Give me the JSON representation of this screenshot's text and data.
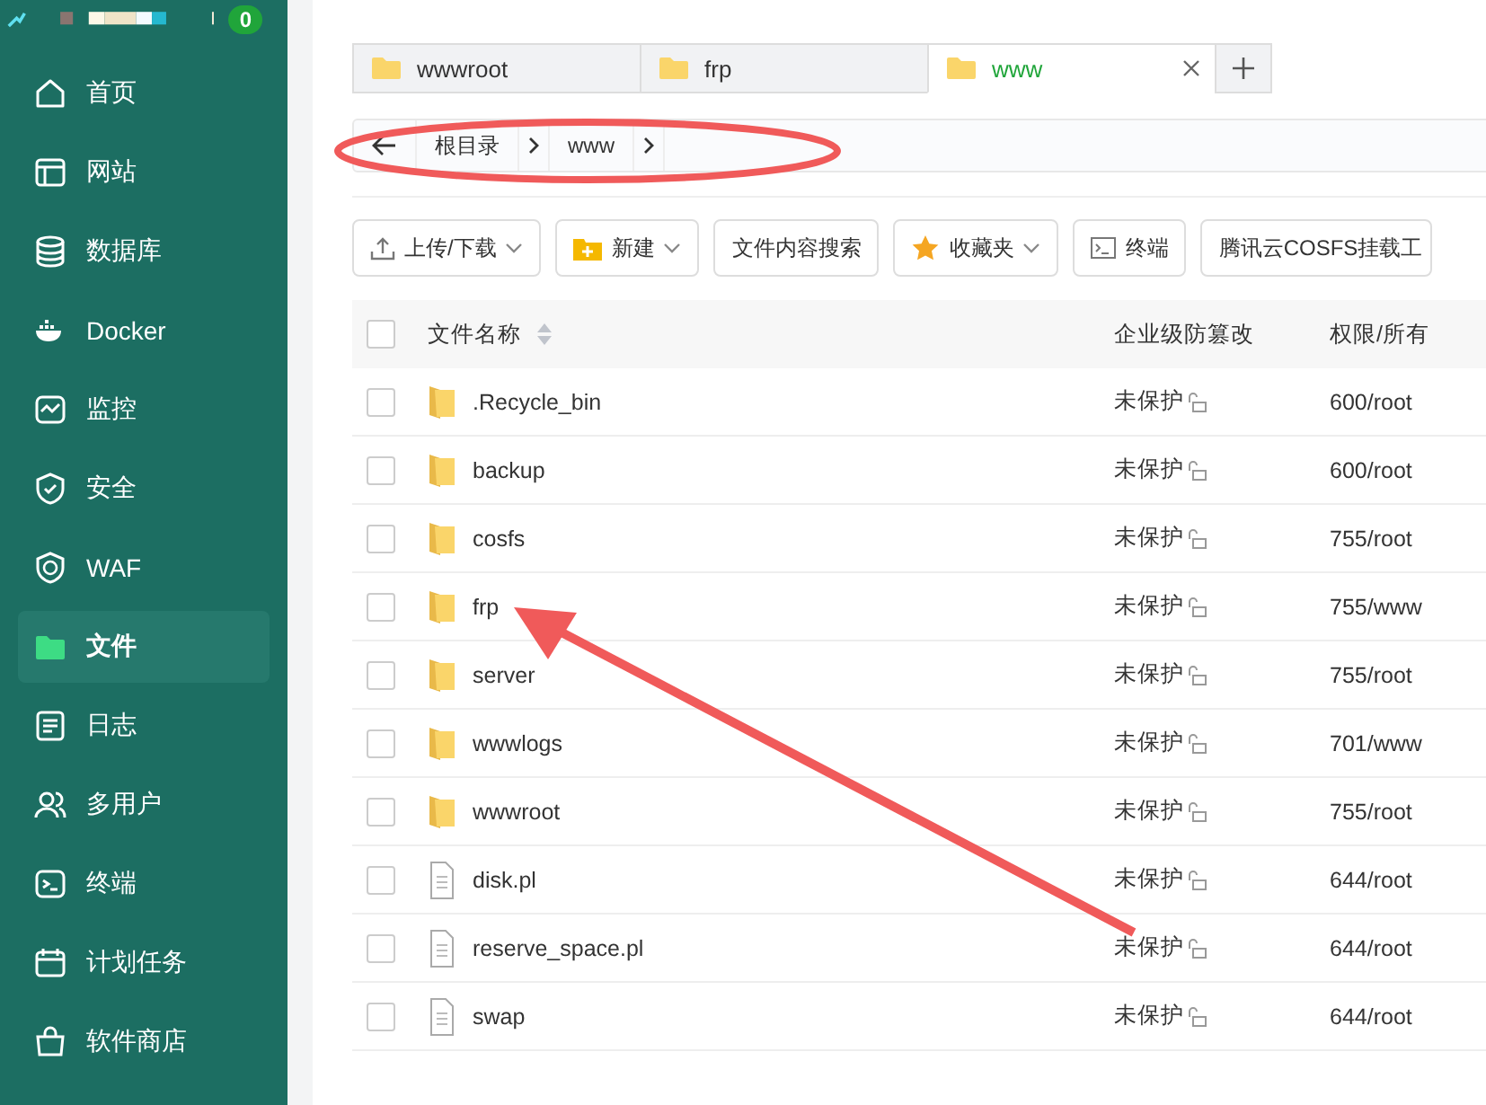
{
  "sidebar": {
    "badge": "0",
    "items": [
      {
        "label": "首页",
        "selected": false
      },
      {
        "label": "网站",
        "selected": false
      },
      {
        "label": "数据库",
        "selected": false
      },
      {
        "label": "Docker",
        "selected": false
      },
      {
        "label": "监控",
        "selected": false
      },
      {
        "label": "安全",
        "selected": false
      },
      {
        "label": "WAF",
        "selected": false
      },
      {
        "label": "文件",
        "selected": true
      },
      {
        "label": "日志",
        "selected": false
      },
      {
        "label": "多用户",
        "selected": false
      },
      {
        "label": "终端",
        "selected": false
      },
      {
        "label": "计划任务",
        "selected": false
      },
      {
        "label": "软件商店",
        "selected": false
      }
    ]
  },
  "tabs": [
    {
      "label": "wwwroot",
      "selected": false
    },
    {
      "label": "frp",
      "selected": false
    },
    {
      "label": "www",
      "selected": true
    }
  ],
  "breadcrumb": [
    "根目录",
    "www"
  ],
  "toolbar": [
    {
      "label": "上传/下载",
      "kind": "upload"
    },
    {
      "label": "新建",
      "kind": "new"
    },
    {
      "label": "文件内容搜索",
      "kind": "plain"
    },
    {
      "label": "收藏夹",
      "kind": "star"
    },
    {
      "label": "终端",
      "kind": "terminal"
    },
    {
      "label": "腾讯云COSFS挂载工",
      "kind": "plain"
    }
  ],
  "table": {
    "select_all_checked": false,
    "columns": [
      "文件名称",
      "企业级防篡改",
      "权限/所有"
    ],
    "rows": [
      {
        "kind": "folder",
        "name": ".Recycle_bin",
        "protection": "未保护",
        "perms": "600/root",
        "checked": false
      },
      {
        "kind": "folder",
        "name": "backup",
        "protection": "未保护",
        "perms": "600/root",
        "checked": false
      },
      {
        "kind": "folder",
        "name": "cosfs",
        "protection": "未保护",
        "perms": "755/root",
        "checked": false
      },
      {
        "kind": "folder",
        "name": "frp",
        "protection": "未保护",
        "perms": "755/www",
        "checked": false
      },
      {
        "kind": "folder",
        "name": "server",
        "protection": "未保护",
        "perms": "755/root",
        "checked": false
      },
      {
        "kind": "folder",
        "name": "wwwlogs",
        "protection": "未保护",
        "perms": "701/www",
        "checked": false
      },
      {
        "kind": "folder",
        "name": "wwwroot",
        "protection": "未保护",
        "perms": "755/root",
        "checked": false
      },
      {
        "kind": "file",
        "name": "disk.pl",
        "protection": "未保护",
        "perms": "644/root",
        "checked": false
      },
      {
        "kind": "file",
        "name": "reserve_space.pl",
        "protection": "未保护",
        "perms": "644/root",
        "checked": false
      },
      {
        "kind": "file",
        "name": "swap",
        "protection": "未保护",
        "perms": "644/root",
        "checked": false
      }
    ]
  }
}
